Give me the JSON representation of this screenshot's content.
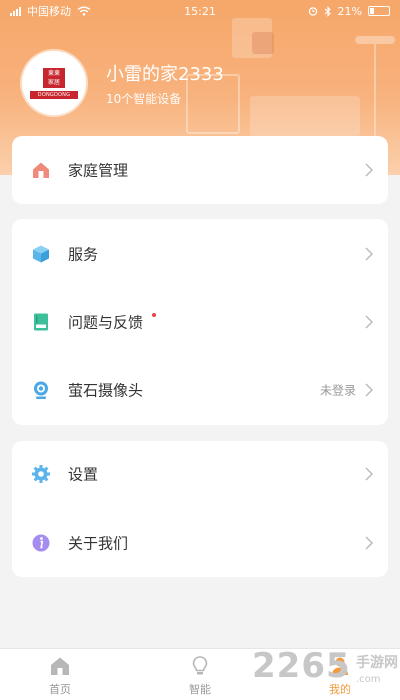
{
  "status_bar": {
    "carrier": "中国移动",
    "time": "15:21",
    "battery": "21%"
  },
  "profile": {
    "home_name": "小雷的家2333",
    "device_count": "10个智能设备",
    "logo_line1": "東東",
    "logo_line2": "家居",
    "logo_brand": "DONGDONG"
  },
  "menu": {
    "group1": [
      {
        "label": "家庭管理",
        "icon": "house-icon"
      }
    ],
    "group2": [
      {
        "label": "服务",
        "icon": "cube-icon"
      },
      {
        "label": "问题与反馈",
        "icon": "book-icon"
      },
      {
        "label": "萤石摄像头",
        "icon": "camera-icon",
        "status": "未登录"
      }
    ],
    "group3": [
      {
        "label": "设置",
        "icon": "gear-icon"
      },
      {
        "label": "关于我们",
        "icon": "info-icon"
      }
    ]
  },
  "tabbar": {
    "tabs": [
      {
        "label": "首页",
        "icon": "home-icon"
      },
      {
        "label": "智能",
        "icon": "bulb-icon"
      },
      {
        "label": "我的",
        "icon": "profile-icon",
        "active": true
      }
    ]
  },
  "watermark": {
    "number": "2265",
    "site": "手游网",
    "url": ".com"
  },
  "colors": {
    "header": "#f6a769",
    "accent": "#f39a3f",
    "house": "#f08a7a",
    "cube": "#5bb5ea",
    "book": "#3dbf9a",
    "camera": "#4aa8e6",
    "gear": "#5bb5ea",
    "info": "#a68cf0"
  }
}
